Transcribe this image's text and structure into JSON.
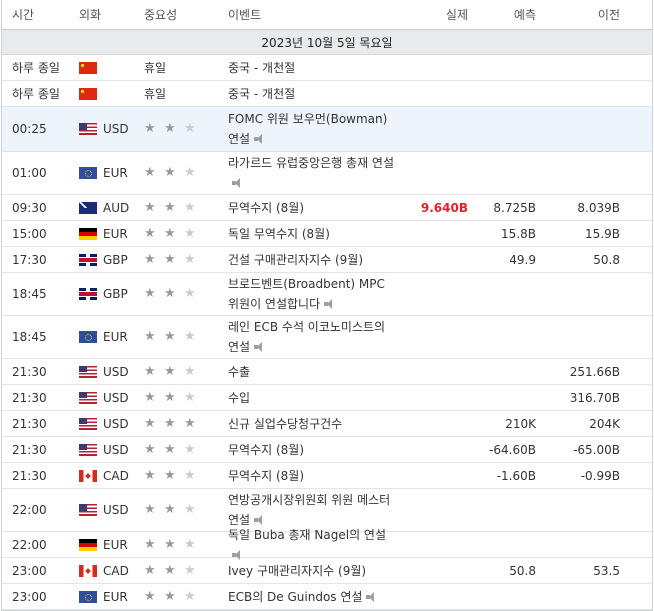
{
  "header": {
    "time": "시간",
    "currency": "외화",
    "importance": "중요성",
    "event": "이벤트",
    "actual": "실제",
    "forecast": "예측",
    "previous": "이전"
  },
  "date_label": "2023년 10월 5일 목요일",
  "rows": [
    {
      "time": "하루 종일",
      "flag": "cn",
      "currency": "",
      "stars": 0,
      "holiday": "휴일",
      "event": "중국 - 개천절",
      "actual": "",
      "forecast": "",
      "previous": "",
      "h": 26
    },
    {
      "time": "하루 종일",
      "flag": "cn",
      "currency": "",
      "stars": 0,
      "holiday": "휴일",
      "event": "중국 - 개천절",
      "actual": "",
      "forecast": "",
      "previous": "",
      "h": 26
    },
    {
      "time": "00:25",
      "flag": "us",
      "currency": "USD",
      "stars": 2,
      "event": "FOMC 위원 보우먼(Bowman) 연설",
      "speech": true,
      "actual": "",
      "forecast": "",
      "previous": "",
      "h": 45,
      "hl": true
    },
    {
      "time": "01:00",
      "flag": "eu",
      "currency": "EUR",
      "stars": 2,
      "event": "라가르드 유럽중앙은행 총재 연설",
      "speech": true,
      "actual": "",
      "forecast": "",
      "previous": "",
      "h": 43
    },
    {
      "time": "09:30",
      "flag": "au",
      "currency": "AUD",
      "stars": 2,
      "event": "무역수지 (8월)",
      "actual": "9.640B",
      "forecast": "8.725B",
      "previous": "8.039B",
      "h": 26,
      "actual_red": true
    },
    {
      "time": "15:00",
      "flag": "de",
      "currency": "EUR",
      "stars": 2,
      "event": "독일 무역수지 (8월)",
      "actual": "",
      "forecast": "15.8B",
      "previous": "15.9B",
      "h": 26
    },
    {
      "time": "17:30",
      "flag": "gb",
      "currency": "GBP",
      "stars": 2,
      "event": "건설 구매관리자지수 (9월)",
      "actual": "",
      "forecast": "49.9",
      "previous": "50.8",
      "h": 26
    },
    {
      "time": "18:45",
      "flag": "gb",
      "currency": "GBP",
      "stars": 2,
      "event": "브로드벤트(Broadbent) MPC 위원이 연설합니다",
      "speech": true,
      "actual": "",
      "forecast": "",
      "previous": "",
      "h": 43
    },
    {
      "time": "18:45",
      "flag": "eu",
      "currency": "EUR",
      "stars": 2,
      "event": "레인 ECB 수석 이코노미스트의 연설",
      "speech": true,
      "actual": "",
      "forecast": "",
      "previous": "",
      "h": 43
    },
    {
      "time": "21:30",
      "flag": "us",
      "currency": "USD",
      "stars": 2,
      "event": "수출",
      "actual": "",
      "forecast": "",
      "previous": "251.66B",
      "h": 26
    },
    {
      "time": "21:30",
      "flag": "us",
      "currency": "USD",
      "stars": 2,
      "event": "수입",
      "actual": "",
      "forecast": "",
      "previous": "316.70B",
      "h": 26
    },
    {
      "time": "21:30",
      "flag": "us",
      "currency": "USD",
      "stars": 3,
      "event": "신규 실업수당청구건수",
      "actual": "",
      "forecast": "210K",
      "previous": "204K",
      "h": 26
    },
    {
      "time": "21:30",
      "flag": "us",
      "currency": "USD",
      "stars": 2,
      "event": "무역수지 (8월)",
      "actual": "",
      "forecast": "-64.60B",
      "previous": "-65.00B",
      "h": 26
    },
    {
      "time": "21:30",
      "flag": "ca",
      "currency": "CAD",
      "stars": 2,
      "event": "무역수지 (8월)",
      "actual": "",
      "forecast": "-1.60B",
      "previous": "-0.99B",
      "h": 26
    },
    {
      "time": "22:00",
      "flag": "us",
      "currency": "USD",
      "stars": 2,
      "event": "연방공개시장위원회 위원 메스터 연설",
      "speech": true,
      "actual": "",
      "forecast": "",
      "previous": "",
      "h": 43
    },
    {
      "time": "22:00",
      "flag": "de",
      "currency": "EUR",
      "stars": 2,
      "event": "독일 Buba 총재 Nagel의 연설",
      "speech": true,
      "actual": "",
      "forecast": "",
      "previous": "",
      "h": 26
    },
    {
      "time": "23:00",
      "flag": "ca",
      "currency": "CAD",
      "stars": 2,
      "event": "Ivey 구매관리자지수 (9월)",
      "actual": "",
      "forecast": "50.8",
      "previous": "53.5",
      "h": 26
    },
    {
      "time": "23:00",
      "flag": "eu",
      "currency": "EUR",
      "stars": 2,
      "event": "ECB의 De Guindos 연설",
      "speech": true,
      "actual": "",
      "forecast": "",
      "previous": "",
      "h": 26
    }
  ]
}
